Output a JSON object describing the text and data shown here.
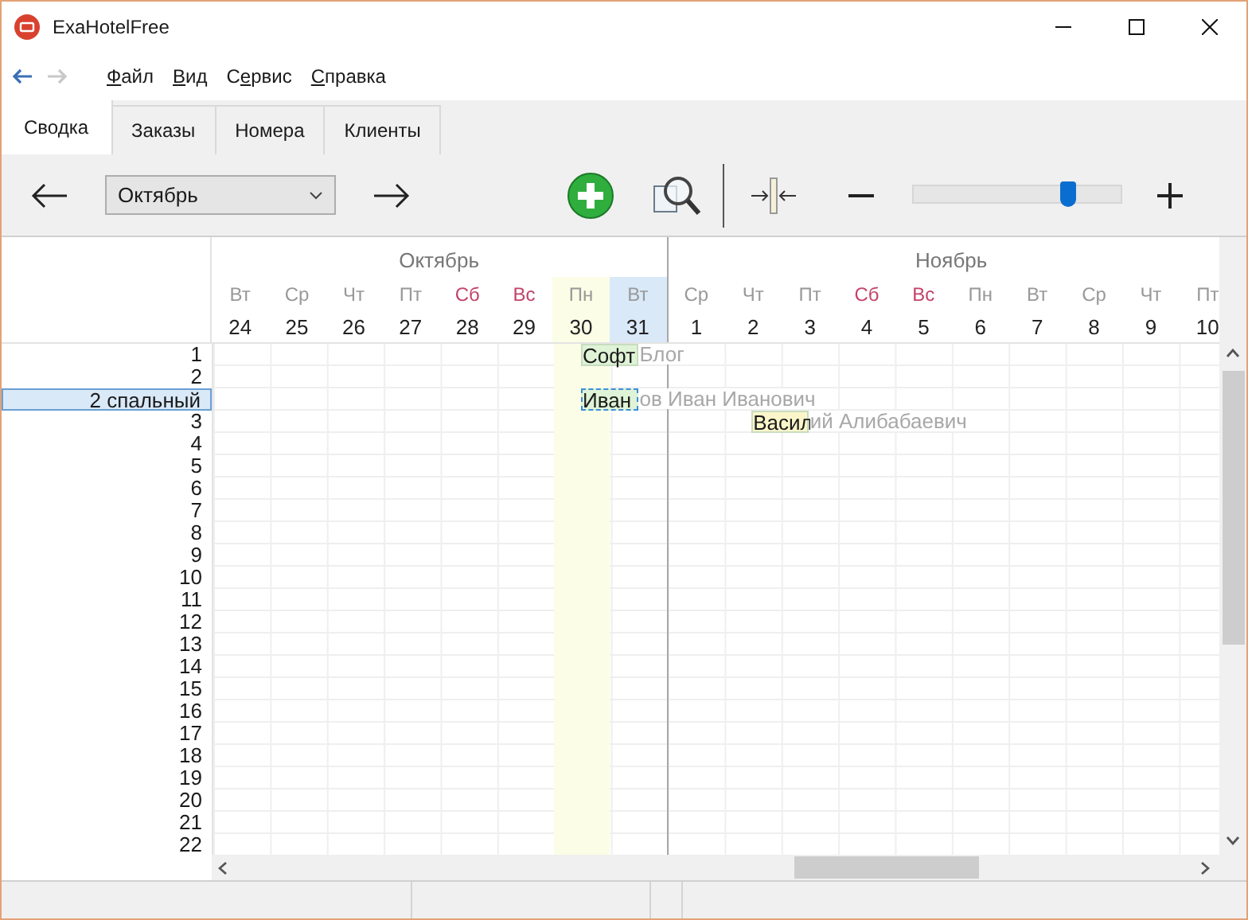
{
  "window": {
    "title": "ExaHotelFree"
  },
  "nav": {
    "back_disabled": false,
    "forward_disabled": true
  },
  "menu": [
    {
      "accel": "Ф",
      "rest": "айл"
    },
    {
      "accel": "В",
      "rest": "ид"
    },
    {
      "before": "С",
      "accel": "е",
      "rest": "рвис"
    },
    {
      "accel": "С",
      "rest": "правка"
    }
  ],
  "tabs": [
    {
      "label": "Сводка",
      "selected": true
    },
    {
      "label": "Заказы",
      "selected": false
    },
    {
      "label": "Номера",
      "selected": false
    },
    {
      "label": "Клиенты",
      "selected": false
    }
  ],
  "toolbar": {
    "month_select": "Октябрь",
    "zoom": {
      "level": 0.74
    }
  },
  "calendar": {
    "months": [
      {
        "label": "Октябрь",
        "days": [
          {
            "weekday": "Вт",
            "date": "24",
            "weekend": false,
            "today": false,
            "selected": false
          },
          {
            "weekday": "Ср",
            "date": "25",
            "weekend": false,
            "today": false,
            "selected": false
          },
          {
            "weekday": "Чт",
            "date": "26",
            "weekend": false,
            "today": false,
            "selected": false
          },
          {
            "weekday": "Пт",
            "date": "27",
            "weekend": false,
            "today": false,
            "selected": false
          },
          {
            "weekday": "Сб",
            "date": "28",
            "weekend": true,
            "today": false,
            "selected": false
          },
          {
            "weekday": "Вс",
            "date": "29",
            "weekend": true,
            "today": false,
            "selected": false
          },
          {
            "weekday": "Пн",
            "date": "30",
            "weekend": false,
            "today": true,
            "selected": false
          },
          {
            "weekday": "Вт",
            "date": "31",
            "weekend": false,
            "today": false,
            "selected": true
          }
        ]
      },
      {
        "label": "Ноябрь",
        "days": [
          {
            "weekday": "Ср",
            "date": "1",
            "weekend": false,
            "today": false,
            "selected": false
          },
          {
            "weekday": "Чт",
            "date": "2",
            "weekend": false,
            "today": false,
            "selected": false
          },
          {
            "weekday": "Пт",
            "date": "3",
            "weekend": false,
            "today": false,
            "selected": false
          },
          {
            "weekday": "Сб",
            "date": "4",
            "weekend": true,
            "today": false,
            "selected": false
          },
          {
            "weekday": "Вс",
            "date": "5",
            "weekend": true,
            "today": false,
            "selected": false
          },
          {
            "weekday": "Пн",
            "date": "6",
            "weekend": false,
            "today": false,
            "selected": false
          },
          {
            "weekday": "Вт",
            "date": "7",
            "weekend": false,
            "today": false,
            "selected": false
          },
          {
            "weekday": "Ср",
            "date": "8",
            "weekend": false,
            "today": false,
            "selected": false
          },
          {
            "weekday": "Чт",
            "date": "9",
            "weekend": false,
            "today": false,
            "selected": false
          },
          {
            "weekday": "Пт",
            "date": "10",
            "weekend": false,
            "today": false,
            "selected": false
          }
        ]
      }
    ],
    "rows": [
      {
        "label": "1",
        "selected": false,
        "cells": [
          {
            "kind": "free"
          },
          {
            "kind": "free"
          },
          {
            "kind": "free"
          },
          {
            "kind": "free"
          },
          {
            "kind": "free"
          },
          {
            "kind": "free"
          },
          {
            "kind": "booking",
            "inside": "Софт",
            "outside": "Блог",
            "color": "#dff3d6",
            "selected": false
          }
        ]
      },
      {
        "label": "2",
        "selected": false
      },
      {
        "label": "2 спальный",
        "selected": true,
        "cells": [
          {
            "kind": "free"
          },
          {
            "kind": "free"
          },
          {
            "kind": "free"
          },
          {
            "kind": "free"
          },
          {
            "kind": "free"
          },
          {
            "kind": "free"
          },
          {
            "kind": "booking",
            "inside": "Иван",
            "outside": "ов Иван Иванович",
            "color": "#dff3d6",
            "selected": true
          }
        ]
      },
      {
        "label": "3",
        "selected": false,
        "cells": [
          {
            "kind": "free"
          },
          {
            "kind": "free"
          },
          {
            "kind": "free"
          },
          {
            "kind": "free"
          },
          {
            "kind": "free"
          },
          {
            "kind": "free"
          },
          {
            "kind": "free"
          },
          {
            "kind": "free"
          },
          {
            "kind": "free"
          },
          {
            "kind": "booking",
            "inside": "Васил",
            "outside": "ий Алибабаевич",
            "color": "#fbf6c9",
            "selected": false
          }
        ]
      },
      {
        "label": "4",
        "selected": false
      },
      {
        "label": "5",
        "selected": false
      },
      {
        "label": "6",
        "selected": false
      },
      {
        "label": "7",
        "selected": false
      },
      {
        "label": "8",
        "selected": false
      },
      {
        "label": "9",
        "selected": false
      },
      {
        "label": "10",
        "selected": false
      },
      {
        "label": "11",
        "selected": false
      },
      {
        "label": "12",
        "selected": false
      },
      {
        "label": "13",
        "selected": false
      },
      {
        "label": "14",
        "selected": false
      },
      {
        "label": "15",
        "selected": false
      },
      {
        "label": "16",
        "selected": false
      },
      {
        "label": "17",
        "selected": false
      },
      {
        "label": "18",
        "selected": false
      },
      {
        "label": "19",
        "selected": false
      },
      {
        "label": "20",
        "selected": false
      },
      {
        "label": "21",
        "selected": false
      },
      {
        "label": "22",
        "selected": false
      }
    ]
  }
}
